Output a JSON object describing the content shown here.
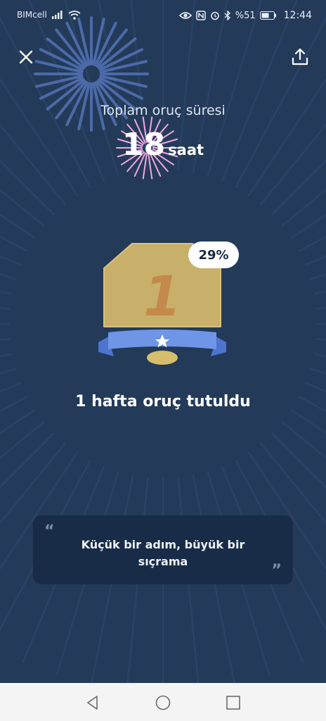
{
  "status_bar": {
    "carrier": "BIMcell",
    "battery_percent": "%51",
    "time": "12:44",
    "icons": [
      "signal-icon",
      "wifi-icon",
      "eye-icon",
      "nfc-icon",
      "alarm-icon",
      "bluetooth-icon",
      "battery-icon"
    ]
  },
  "header": {
    "close_icon": "close-icon",
    "share_icon": "share-icon"
  },
  "summary": {
    "label": "Toplam oruç süresi",
    "value": "18",
    "unit": "saat"
  },
  "badge": {
    "number": "1",
    "progress_label": "29%",
    "progress": 0.29,
    "icon": "star-icon"
  },
  "milestone": {
    "title": "1 hafta oruç tutuldu"
  },
  "quote": {
    "open_mark": "“",
    "text": "Küçük bir adım, büyük bir sıçrama",
    "close_mark": "”"
  },
  "nav_bar": {
    "icons": [
      "back-icon",
      "home-icon",
      "recents-icon"
    ]
  },
  "colors": {
    "background": "#233a58",
    "card": "#182b47",
    "badge_gold": "#c9b06a",
    "ribbon_blue": "#6f95e6",
    "firework_pink": "#f0a8e0"
  }
}
